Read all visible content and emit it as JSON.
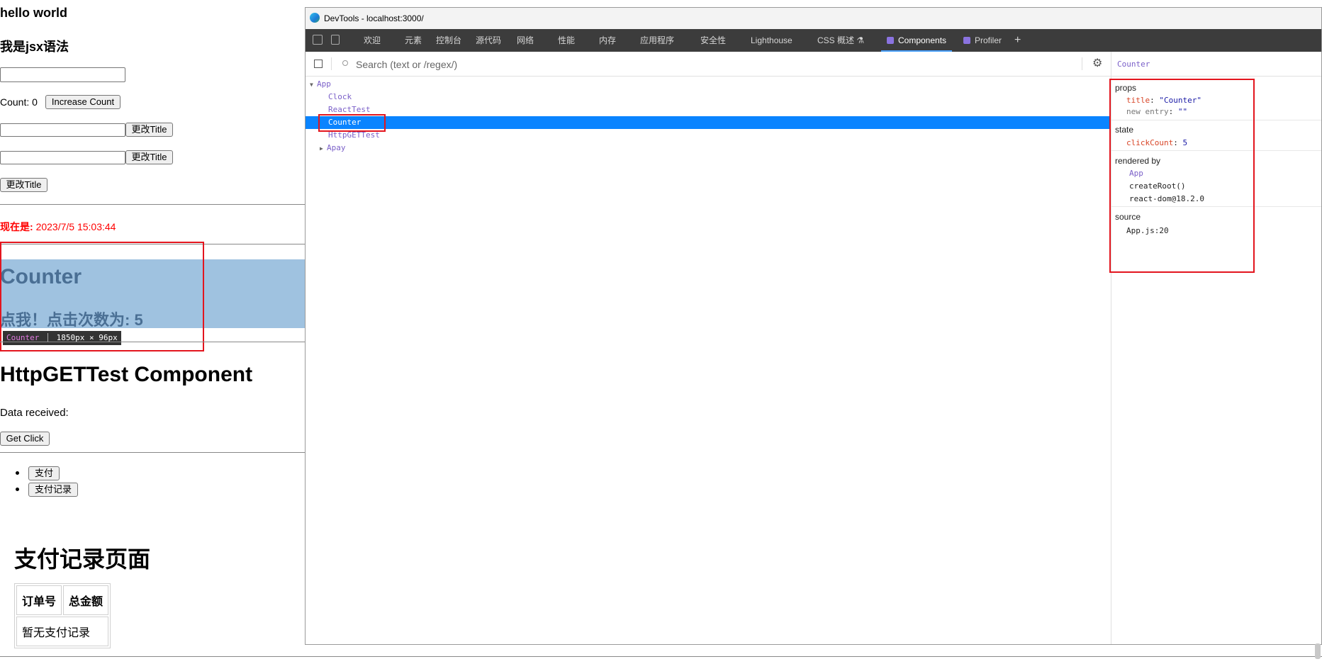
{
  "page": {
    "heading": "hello world",
    "jsx_heading": "我是jsx语法",
    "count_label": "Count: 0",
    "increase_button": "Increase Count",
    "change_title_button_1": "更改Title",
    "change_title_button_2": "更改Title",
    "change_title_button_3": "更改Title",
    "now_label": "现在是:",
    "now_value": "2023/7/5 15:03:44",
    "counter_title": "Counter",
    "counter_click_text": "点我！点击次数为: 5",
    "http_heading": "HttpGETTest Component",
    "data_received": "Data received:",
    "get_click_button": "Get Click",
    "nav_items": [
      "支付",
      "支付记录"
    ],
    "payment_heading": "支付记录页面",
    "table_headers": [
      "订单号",
      "总金额"
    ],
    "table_empty": "暂无支付记录"
  },
  "highlight_tooltip": {
    "name": "Counter",
    "size": "1850px × 96px"
  },
  "devtools": {
    "title": "DevTools - localhost:3000/",
    "tabs": [
      "欢迎",
      "元素",
      "控制台",
      "源代码",
      "网络",
      "性能",
      "内存",
      "应用程序",
      "安全性",
      "Lighthouse",
      "CSS 概述 ⚗",
      "Components",
      "Profiler",
      "+"
    ],
    "active_tab": "Components",
    "search_placeholder": "Search (text or /regex/)",
    "tree": [
      "App",
      "Clock",
      "ReactTest",
      "Counter",
      "HttpGETTest",
      "Apay"
    ],
    "selected": "Counter",
    "sidebar": {
      "component": "Counter",
      "props_title": "props",
      "props": [
        {
          "key": "title",
          "value": "\"Counter\""
        },
        {
          "key": "new entry",
          "value": "\"\""
        }
      ],
      "state_title": "state",
      "state": [
        {
          "key": "clickCount",
          "value": "5"
        }
      ],
      "rendered_by_title": "rendered by",
      "rendered_by": [
        "App",
        "createRoot()",
        "react-dom@18.2.0"
      ],
      "source_title": "source",
      "source": "App.js:20"
    }
  },
  "colors": {
    "accent_red": "#e3151e",
    "selection_blue": "#0a84ff",
    "highlight_overlay": "#9fc2e0",
    "react_purple": "#7a5fc8"
  }
}
